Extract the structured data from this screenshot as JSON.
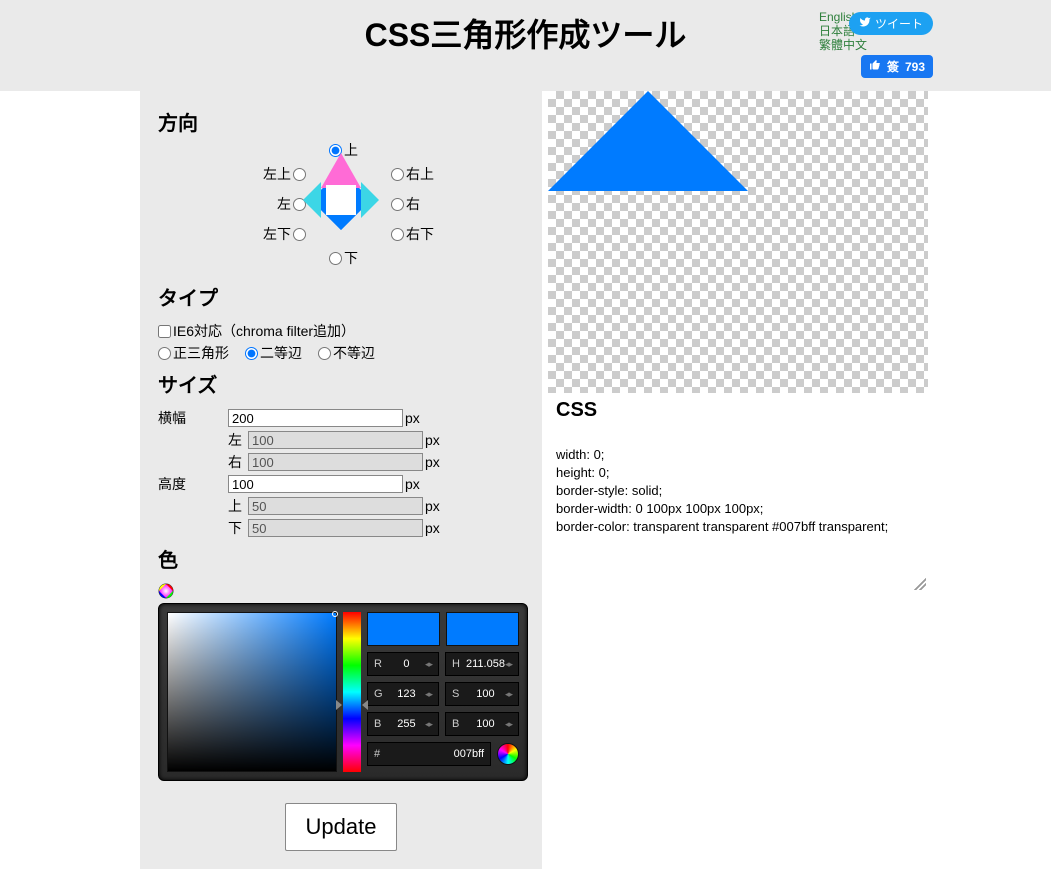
{
  "header": {
    "title": "CSS三角形作成ツール",
    "langs": [
      "English",
      "日本語",
      "繁體中文"
    ],
    "tweet_label": "ツイート",
    "like_label": "簽",
    "like_count": "793"
  },
  "direction": {
    "heading": "方向",
    "options": {
      "top": "上",
      "topleft": "左上",
      "topright": "右上",
      "left": "左",
      "right": "右",
      "botleft": "左下",
      "botright": "右下",
      "bot": "下"
    },
    "selected": "top"
  },
  "type": {
    "heading": "タイプ",
    "ie6_label": "IE6対応（chroma filter追加）",
    "ie6_checked": false,
    "shape_options": {
      "equilateral": "正三角形",
      "isosceles": "二等辺",
      "scalene": "不等辺"
    },
    "shape_selected": "isosceles"
  },
  "size": {
    "heading": "サイズ",
    "width_label": "横幅",
    "width_value": "200",
    "width_left_label": "左",
    "width_left_value": "100",
    "width_right_label": "右",
    "width_right_value": "100",
    "height_label": "高度",
    "height_value": "100",
    "height_top_label": "上",
    "height_top_value": "50",
    "height_bot_label": "下",
    "height_bot_value": "50",
    "unit": "px"
  },
  "color": {
    "heading": "色",
    "rgb": {
      "R": "0",
      "G": "123",
      "B": "255"
    },
    "hsb": {
      "H": "211.058",
      "S": "100",
      "B": "100"
    },
    "hex": "007bff"
  },
  "update_label": "Update",
  "css_output": {
    "heading": "CSS",
    "lines": [
      "width: 0;",
      "height: 0;",
      "border-style: solid;",
      "border-width: 0 100px 100px 100px;",
      "border-color: transparent transparent #007bff transparent;"
    ]
  }
}
